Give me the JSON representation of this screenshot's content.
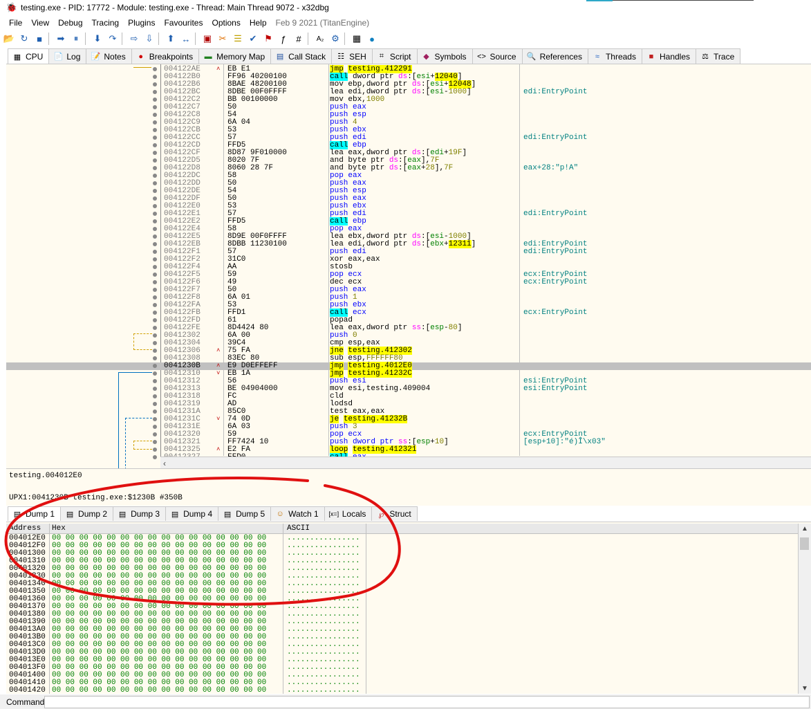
{
  "window": {
    "title": "testing.exe - PID: 17772 - Module: testing.exe - Thread: Main Thread 9072 - x32dbg"
  },
  "menu": {
    "items": [
      "File",
      "View",
      "Debug",
      "Tracing",
      "Plugins",
      "Favourites",
      "Options",
      "Help"
    ],
    "build": "Feb 9 2021 (TitanEngine)"
  },
  "toolbar": {
    "icons": [
      "open-icon",
      "restart-icon",
      "stop-icon",
      "run-icon",
      "pause-icon",
      "step-into-icon",
      "step-over-icon",
      "trace-into-icon",
      "trace-over-icon",
      "execute-till-return-icon",
      "run-to-user-code-icon",
      "scylla-icon",
      "patch-icon",
      "comment-icon",
      "label-icon",
      "bookmark-icon",
      "function-icon",
      "hash-icon",
      "font-icon",
      "preferences-icon",
      "calculator-icon",
      "globe-icon"
    ]
  },
  "tabs": [
    {
      "label": "CPU",
      "icon": "cpu-icon",
      "active": true
    },
    {
      "label": "Log",
      "icon": "log-icon"
    },
    {
      "label": "Notes",
      "icon": "notes-icon"
    },
    {
      "label": "Breakpoints",
      "icon": "breakpoint-icon"
    },
    {
      "label": "Memory Map",
      "icon": "memory-icon"
    },
    {
      "label": "Call Stack",
      "icon": "callstack-icon"
    },
    {
      "label": "SEH",
      "icon": "seh-icon"
    },
    {
      "label": "Script",
      "icon": "script-icon"
    },
    {
      "label": "Symbols",
      "icon": "symbols-icon"
    },
    {
      "label": "Source",
      "icon": "source-icon"
    },
    {
      "label": "References",
      "icon": "references-icon"
    },
    {
      "label": "Threads",
      "icon": "threads-icon"
    },
    {
      "label": "Handles",
      "icon": "handles-icon"
    },
    {
      "label": "Trace",
      "icon": "trace-icon"
    }
  ],
  "disasm": [
    {
      "a": "004122AE",
      "arr": "^",
      "b": "EB E1",
      "d": [
        [
          "jmp",
          "jmp"
        ],
        [
          " "
        ],
        [
          "testing.412291",
          "jmpt"
        ]
      ],
      "c": ""
    },
    {
      "a": "004122B0",
      "b": "FF96 40200100",
      "d": [
        [
          "call",
          "call"
        ],
        [
          " dword ptr "
        ],
        [
          "ds",
          "seg"
        ],
        [
          ":["
        ],
        [
          "esi",
          "reg"
        ],
        [
          "+"
        ],
        [
          "12040",
          "hl"
        ],
        [
          "]"
        ]
      ],
      "c": ""
    },
    {
      "a": "004122B6",
      "b": "8BAE 48200100",
      "d": [
        [
          "mov ebp,dword ptr "
        ],
        [
          "ds",
          "seg"
        ],
        [
          ":["
        ],
        [
          "esi",
          "reg"
        ],
        [
          "+"
        ],
        [
          "12048",
          "hl"
        ],
        [
          "]"
        ]
      ],
      "c": ""
    },
    {
      "a": "004122BC",
      "b": "8DBE 00F0FFFF",
      "d": [
        [
          "lea edi,dword ptr "
        ],
        [
          "ds",
          "seg"
        ],
        [
          ":["
        ],
        [
          "esi",
          "reg"
        ],
        [
          "-"
        ],
        [
          "1000",
          "num"
        ],
        [
          "]"
        ]
      ],
      "c": "edi:EntryPoint"
    },
    {
      "a": "004122C2",
      "b": "BB 00100000",
      "d": [
        [
          "mov ebx,"
        ],
        [
          "1000",
          "num"
        ]
      ],
      "c": ""
    },
    {
      "a": "004122C7",
      "b": "50",
      "d": [
        [
          "push eax",
          "push"
        ]
      ],
      "c": ""
    },
    {
      "a": "004122C8",
      "b": "54",
      "d": [
        [
          "push esp",
          "push"
        ]
      ],
      "c": ""
    },
    {
      "a": "004122C9",
      "b": "6A 04",
      "d": [
        [
          "push ",
          "push"
        ],
        [
          "4",
          "num"
        ]
      ],
      "c": ""
    },
    {
      "a": "004122CB",
      "b": "53",
      "d": [
        [
          "push ebx",
          "push"
        ]
      ],
      "c": ""
    },
    {
      "a": "004122CC",
      "b": "57",
      "d": [
        [
          "push edi",
          "push"
        ]
      ],
      "c": "edi:EntryPoint"
    },
    {
      "a": "004122CD",
      "b": "FFD5",
      "d": [
        [
          "call",
          "call"
        ],
        [
          " ebp",
          "push"
        ]
      ],
      "c": ""
    },
    {
      "a": "004122CF",
      "b": "8D87 9F010000",
      "d": [
        [
          "lea eax,dword ptr "
        ],
        [
          "ds",
          "seg"
        ],
        [
          ":["
        ],
        [
          "edi",
          "reg"
        ],
        [
          "+"
        ],
        [
          "19F",
          "num"
        ],
        [
          "]"
        ]
      ],
      "c": ""
    },
    {
      "a": "004122D5",
      "b": "8020 7F",
      "d": [
        [
          "and byte ptr "
        ],
        [
          "ds",
          "seg"
        ],
        [
          ":["
        ],
        [
          "eax",
          "reg"
        ],
        [
          "],"
        ],
        [
          "7F",
          "num"
        ]
      ],
      "c": ""
    },
    {
      "a": "004122D8",
      "b": "8060 28 7F",
      "d": [
        [
          "and byte ptr "
        ],
        [
          "ds",
          "seg"
        ],
        [
          ":["
        ],
        [
          "eax",
          "reg"
        ],
        [
          "+"
        ],
        [
          "28",
          "num"
        ],
        [
          "],"
        ],
        [
          "7F",
          "num"
        ]
      ],
      "c": "eax+28:\"p!A\""
    },
    {
      "a": "004122DC",
      "b": "58",
      "d": [
        [
          "pop eax",
          "push"
        ]
      ],
      "c": ""
    },
    {
      "a": "004122DD",
      "b": "50",
      "d": [
        [
          "push eax",
          "push"
        ]
      ],
      "c": ""
    },
    {
      "a": "004122DE",
      "b": "54",
      "d": [
        [
          "push esp",
          "push"
        ]
      ],
      "c": ""
    },
    {
      "a": "004122DF",
      "b": "50",
      "d": [
        [
          "push eax",
          "push"
        ]
      ],
      "c": ""
    },
    {
      "a": "004122E0",
      "b": "53",
      "d": [
        [
          "push ebx",
          "push"
        ]
      ],
      "c": ""
    },
    {
      "a": "004122E1",
      "b": "57",
      "d": [
        [
          "push edi",
          "push"
        ]
      ],
      "c": "edi:EntryPoint"
    },
    {
      "a": "004122E2",
      "b": "FFD5",
      "d": [
        [
          "call",
          "call"
        ],
        [
          " ebp",
          "push"
        ]
      ],
      "c": ""
    },
    {
      "a": "004122E4",
      "b": "58",
      "d": [
        [
          "pop eax",
          "push"
        ]
      ],
      "c": ""
    },
    {
      "a": "004122E5",
      "b": "8D9E 00F0FFFF",
      "d": [
        [
          "lea ebx,dword ptr "
        ],
        [
          "ds",
          "seg"
        ],
        [
          ":["
        ],
        [
          "esi",
          "reg"
        ],
        [
          "-"
        ],
        [
          "1000",
          "num"
        ],
        [
          "]"
        ]
      ],
      "c": ""
    },
    {
      "a": "004122EB",
      "b": "8DBB 11230100",
      "d": [
        [
          "lea edi,dword ptr "
        ],
        [
          "ds",
          "seg"
        ],
        [
          ":["
        ],
        [
          "ebx",
          "reg"
        ],
        [
          "+"
        ],
        [
          "12311",
          "hl"
        ],
        [
          "]"
        ]
      ],
      "c": "edi:EntryPoint"
    },
    {
      "a": "004122F1",
      "b": "57",
      "d": [
        [
          "push edi",
          "push"
        ]
      ],
      "c": "edi:EntryPoint"
    },
    {
      "a": "004122F2",
      "b": "31C0",
      "d": [
        [
          "xor eax,eax"
        ]
      ],
      "c": ""
    },
    {
      "a": "004122F4",
      "b": "AA",
      "d": [
        [
          "stosb"
        ]
      ],
      "c": ""
    },
    {
      "a": "004122F5",
      "b": "59",
      "d": [
        [
          "pop ecx",
          "push"
        ]
      ],
      "c": "ecx:EntryPoint"
    },
    {
      "a": "004122F6",
      "b": "49",
      "d": [
        [
          "dec ecx"
        ]
      ],
      "c": "ecx:EntryPoint"
    },
    {
      "a": "004122F7",
      "b": "50",
      "d": [
        [
          "push eax",
          "push"
        ]
      ],
      "c": ""
    },
    {
      "a": "004122F8",
      "b": "6A 01",
      "d": [
        [
          "push ",
          "push"
        ],
        [
          "1",
          "num"
        ]
      ],
      "c": ""
    },
    {
      "a": "004122FA",
      "b": "53",
      "d": [
        [
          "push ebx",
          "push"
        ]
      ],
      "c": ""
    },
    {
      "a": "004122FB",
      "b": "FFD1",
      "d": [
        [
          "call",
          "call"
        ],
        [
          " ecx",
          "push"
        ]
      ],
      "c": "ecx:EntryPoint"
    },
    {
      "a": "004122FD",
      "b": "61",
      "d": [
        [
          "popad"
        ]
      ],
      "c": ""
    },
    {
      "a": "004122FE",
      "b": "8D4424 80",
      "d": [
        [
          "lea eax,dword ptr "
        ],
        [
          "ss",
          "seg"
        ],
        [
          ":["
        ],
        [
          "esp",
          "reg"
        ],
        [
          "-"
        ],
        [
          "80",
          "num"
        ],
        [
          "]"
        ]
      ],
      "c": ""
    },
    {
      "a": "00412302",
      "b": "6A 00",
      "d": [
        [
          "push ",
          "push"
        ],
        [
          "0",
          "num"
        ]
      ],
      "c": ""
    },
    {
      "a": "00412304",
      "b": "39C4",
      "d": [
        [
          "cmp esp,eax"
        ]
      ],
      "c": ""
    },
    {
      "a": "00412306",
      "arr": "^",
      "b": "75 FA",
      "d": [
        [
          "jne",
          "jmp"
        ],
        [
          " "
        ],
        [
          "testing.412302",
          "jmpt"
        ]
      ],
      "c": ""
    },
    {
      "a": "00412308",
      "b": "83EC 80",
      "d": [
        [
          "sub esp,"
        ],
        [
          "FFFFFF80",
          "num"
        ]
      ],
      "c": ""
    },
    {
      "a": "0041230B",
      "arr": "^",
      "b": "E9 D0EFFEFF",
      "d": [
        [
          "jmp",
          "jmp"
        ],
        [
          " "
        ],
        [
          "testing.4012E0",
          "jmpt"
        ]
      ],
      "c": "",
      "sel": true
    },
    {
      "a": "00412310",
      "arr": "v",
      "b": "EB 1A",
      "d": [
        [
          "jmp",
          "jmp"
        ],
        [
          " "
        ],
        [
          "testing.41232C",
          "jmpt"
        ]
      ],
      "c": ""
    },
    {
      "a": "00412312",
      "b": "56",
      "d": [
        [
          "push esi",
          "push"
        ]
      ],
      "c": "esi:EntryPoint"
    },
    {
      "a": "00412313",
      "b": "BE 04904000",
      "d": [
        [
          "mov esi,testing.409004"
        ]
      ],
      "c": "esi:EntryPoint"
    },
    {
      "a": "00412318",
      "b": "FC",
      "d": [
        [
          "cld"
        ]
      ],
      "c": ""
    },
    {
      "a": "00412319",
      "b": "AD",
      "d": [
        [
          "lodsd"
        ]
      ],
      "c": ""
    },
    {
      "a": "0041231A",
      "b": "85C0",
      "d": [
        [
          "test eax,eax"
        ]
      ],
      "c": ""
    },
    {
      "a": "0041231C",
      "arr": "v",
      "b": "74 0D",
      "d": [
        [
          "je",
          "jmp"
        ],
        [
          " "
        ],
        [
          "testing.41232B",
          "jmpt"
        ]
      ],
      "c": ""
    },
    {
      "a": "0041231E",
      "b": "6A 03",
      "d": [
        [
          "push ",
          "push"
        ],
        [
          "3",
          "num"
        ]
      ],
      "c": ""
    },
    {
      "a": "00412320",
      "b": "59",
      "d": [
        [
          "pop ecx",
          "push"
        ]
      ],
      "c": "ecx:EntryPoint"
    },
    {
      "a": "00412321",
      "b": "FF7424 10",
      "d": [
        [
          "push dword ptr ",
          "push"
        ],
        [
          "ss",
          "seg"
        ],
        [
          ":["
        ],
        [
          "esp",
          "reg"
        ],
        [
          "+"
        ],
        [
          "10",
          "num"
        ],
        [
          "]"
        ]
      ],
      "c": "[esp+10]:\"é)Î\\x03\""
    },
    {
      "a": "00412325",
      "arr": "^",
      "b": "E2 FA",
      "d": [
        [
          "loop",
          "jmp"
        ],
        [
          " "
        ],
        [
          "testing.412321",
          "jmpt"
        ]
      ],
      "c": ""
    },
    {
      "a": "00412327",
      "b": "FFD0",
      "d": [
        [
          "call",
          "call"
        ],
        [
          " eax",
          "push"
        ]
      ],
      "c": ""
    }
  ],
  "info": {
    "line1": "testing.004012E0",
    "line2": "UPX1:0041230B testing.exe:$1230B #350B"
  },
  "dump_tabs": [
    {
      "label": "Dump 1",
      "icon": "dump-icon",
      "active": true
    },
    {
      "label": "Dump 2",
      "icon": "dump-icon"
    },
    {
      "label": "Dump 3",
      "icon": "dump-icon"
    },
    {
      "label": "Dump 4",
      "icon": "dump-icon"
    },
    {
      "label": "Dump 5",
      "icon": "dump-icon"
    },
    {
      "label": "Watch 1",
      "icon": "watch-icon"
    },
    {
      "label": "Locals",
      "icon": "locals-icon"
    },
    {
      "label": "Struct",
      "icon": "struct-icon"
    }
  ],
  "dump": {
    "headers": {
      "address": "Address",
      "hex": "Hex",
      "ascii": "ASCII"
    },
    "hex_row": "00 00 00 00 00 00 00 00 00 00 00 00 00 00 00 00",
    "ascii_row": "................",
    "addresses": [
      "004012E0",
      "004012F0",
      "00401300",
      "00401310",
      "00401320",
      "00401330",
      "00401340",
      "00401350",
      "00401360",
      "00401370",
      "00401380",
      "00401390",
      "004013A0",
      "004013B0",
      "004013C0",
      "004013D0",
      "004013E0",
      "004013F0",
      "00401400",
      "00401410",
      "00401420"
    ]
  },
  "command": {
    "label": "Command:",
    "value": ""
  },
  "colors": {
    "background": "#fffbf0",
    "selection": "#c0c0c0",
    "call_highlight": "#00ffff",
    "jump_highlight": "#ffff00",
    "annotation_circle": "#e01010"
  }
}
